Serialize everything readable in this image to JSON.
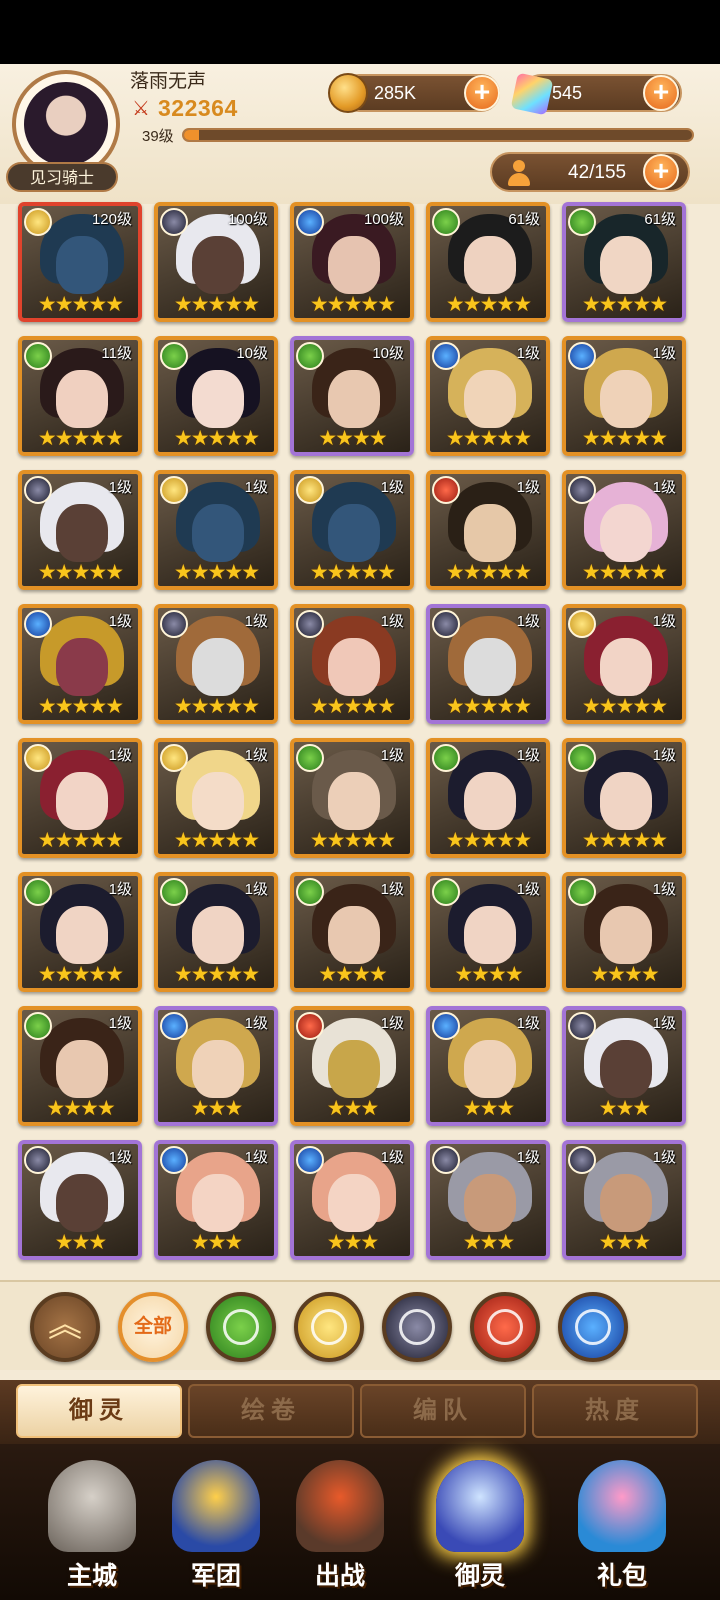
{
  "player": {
    "name": "落雨无声",
    "power": "322364",
    "level": "39级",
    "xp_fraction": 0.03,
    "rank_title": "见习骑士"
  },
  "resources": {
    "gold": "285K",
    "gems": "545",
    "hero_count": "42/155"
  },
  "heroes": [
    {
      "level": "120级",
      "element": "gold",
      "stars": 5,
      "frame": "red",
      "hair": "#1f3a52",
      "skin": "#33567a"
    },
    {
      "level": "100级",
      "element": "dark",
      "stars": 5,
      "frame": "orange",
      "hair": "#e8e8ee",
      "skin": "#5a4036"
    },
    {
      "level": "100级",
      "element": "blue",
      "stars": 5,
      "frame": "orange",
      "hair": "#3a1a22",
      "skin": "#e6c3b0"
    },
    {
      "level": "61级",
      "element": "green",
      "stars": 5,
      "frame": "orange",
      "hair": "#1c1c1c",
      "skin": "#eed2c0"
    },
    {
      "level": "61级",
      "element": "green",
      "stars": 5,
      "frame": "purple",
      "hair": "#18262a",
      "skin": "#f0d6c4"
    },
    {
      "level": "11级",
      "element": "green",
      "stars": 5,
      "frame": "orange",
      "hair": "#2a1a1a",
      "skin": "#f0d0c0"
    },
    {
      "level": "10级",
      "element": "green",
      "stars": 5,
      "frame": "orange",
      "hair": "#161222",
      "skin": "#f3dbd0"
    },
    {
      "level": "10级",
      "element": "green",
      "stars": 4,
      "frame": "purple",
      "hair": "#3a2418",
      "skin": "#e8c8b0"
    },
    {
      "level": "1级",
      "element": "blue",
      "stars": 5,
      "frame": "orange",
      "hair": "#d6b25a",
      "skin": "#f0d4b8"
    },
    {
      "level": "1级",
      "element": "blue",
      "stars": 5,
      "frame": "orange",
      "hair": "#cfa84e",
      "skin": "#efd2b8"
    },
    {
      "level": "1级",
      "element": "dark",
      "stars": 5,
      "frame": "orange",
      "hair": "#e8e8ee",
      "skin": "#5a4036"
    },
    {
      "level": "1级",
      "element": "gold",
      "stars": 5,
      "frame": "orange",
      "hair": "#1f3a52",
      "skin": "#33567a"
    },
    {
      "level": "1级",
      "element": "gold",
      "stars": 5,
      "frame": "orange",
      "hair": "#1f3a52",
      "skin": "#33567a"
    },
    {
      "level": "1级",
      "element": "red",
      "stars": 5,
      "frame": "orange",
      "hair": "#2a2016",
      "skin": "#e6c8a8"
    },
    {
      "level": "1级",
      "element": "dark",
      "stars": 5,
      "frame": "orange",
      "hair": "#e6b2d6",
      "skin": "#f3d6d0"
    },
    {
      "level": "1级",
      "element": "blue",
      "stars": 5,
      "frame": "orange",
      "hair": "#c79a2a",
      "skin": "#8a3a4a"
    },
    {
      "level": "1级",
      "element": "dark",
      "stars": 5,
      "frame": "orange",
      "hair": "#a06a3a",
      "skin": "#dcdcdc"
    },
    {
      "level": "1级",
      "element": "dark",
      "stars": 5,
      "frame": "orange",
      "hair": "#8a3a22",
      "skin": "#f0c8b8"
    },
    {
      "level": "1级",
      "element": "dark",
      "stars": 5,
      "frame": "purple",
      "hair": "#a06a3a",
      "skin": "#dcdcdc"
    },
    {
      "level": "1级",
      "element": "gold",
      "stars": 5,
      "frame": "orange",
      "hair": "#8a2030",
      "skin": "#f2d4c6"
    },
    {
      "level": "1级",
      "element": "gold",
      "stars": 5,
      "frame": "orange",
      "hair": "#8a2030",
      "skin": "#f2d4c6"
    },
    {
      "level": "1级",
      "element": "gold",
      "stars": 5,
      "frame": "orange",
      "hair": "#f0d68a",
      "skin": "#f4dcc8"
    },
    {
      "level": "1级",
      "element": "green",
      "stars": 5,
      "frame": "orange",
      "hair": "#6a5a4a",
      "skin": "#eccfb8"
    },
    {
      "level": "1级",
      "element": "green",
      "stars": 5,
      "frame": "orange",
      "hair": "#1c1c2e",
      "skin": "#f0d4c4"
    },
    {
      "level": "1级",
      "element": "green",
      "stars": 5,
      "frame": "orange",
      "hair": "#1c1c2e",
      "skin": "#f0d4c4"
    },
    {
      "level": "1级",
      "element": "green",
      "stars": 5,
      "frame": "orange",
      "hair": "#1c1c2e",
      "skin": "#f0d4c4"
    },
    {
      "level": "1级",
      "element": "green",
      "stars": 5,
      "frame": "orange",
      "hair": "#1c1c2e",
      "skin": "#f0d4c4"
    },
    {
      "level": "1级",
      "element": "green",
      "stars": 4,
      "frame": "orange",
      "hair": "#3a2418",
      "skin": "#e8c8b0"
    },
    {
      "level": "1级",
      "element": "green",
      "stars": 4,
      "frame": "orange",
      "hair": "#1c1c2e",
      "skin": "#f0d4c4"
    },
    {
      "level": "1级",
      "element": "green",
      "stars": 4,
      "frame": "orange",
      "hair": "#3a2418",
      "skin": "#e8c8b0"
    },
    {
      "level": "1级",
      "element": "green",
      "stars": 4,
      "frame": "orange",
      "hair": "#3a2418",
      "skin": "#e8c8b0"
    },
    {
      "level": "1级",
      "element": "blue",
      "stars": 3,
      "frame": "purple",
      "hair": "#cfa84e",
      "skin": "#efd2b8"
    },
    {
      "level": "1级",
      "element": "red",
      "stars": 3,
      "frame": "orange",
      "hair": "#e8e2d6",
      "skin": "#c8a64a"
    },
    {
      "level": "1级",
      "element": "blue",
      "stars": 3,
      "frame": "purple",
      "hair": "#cfa84e",
      "skin": "#efd2b8"
    },
    {
      "level": "1级",
      "element": "dark",
      "stars": 3,
      "frame": "purple",
      "hair": "#e8e8ee",
      "skin": "#5a4036"
    },
    {
      "level": "1级",
      "element": "dark",
      "stars": 3,
      "frame": "purple",
      "hair": "#e8e8ee",
      "skin": "#5a4036"
    },
    {
      "level": "1级",
      "element": "blue",
      "stars": 3,
      "frame": "purple",
      "hair": "#e8a48a",
      "skin": "#f4d4c4"
    },
    {
      "level": "1级",
      "element": "blue",
      "stars": 3,
      "frame": "purple",
      "hair": "#e8a48a",
      "skin": "#f4d4c4"
    },
    {
      "level": "1级",
      "element": "dark",
      "stars": 3,
      "frame": "purple",
      "hair": "#9a9aa6",
      "skin": "#c89a7a"
    },
    {
      "level": "1级",
      "element": "dark",
      "stars": 3,
      "frame": "purple",
      "hair": "#9a9aa6",
      "skin": "#c89a7a"
    }
  ],
  "filters": {
    "collapse_icon": "double-chevron-up-icon",
    "all_label": "全部",
    "elements": [
      "green",
      "gold",
      "dark",
      "red",
      "blue"
    ]
  },
  "tabs": [
    "御灵",
    "绘卷",
    "编队",
    "热度"
  ],
  "active_tab": 0,
  "nav": [
    "主城",
    "军团",
    "出战",
    "御灵",
    "礼包"
  ],
  "active_nav": 3,
  "colors": {
    "frame_orange": "#e39125",
    "frame_purple": "#a374d6",
    "frame_red": "#e0432c",
    "accent": "#f0912c",
    "star": "#f9c51c"
  }
}
